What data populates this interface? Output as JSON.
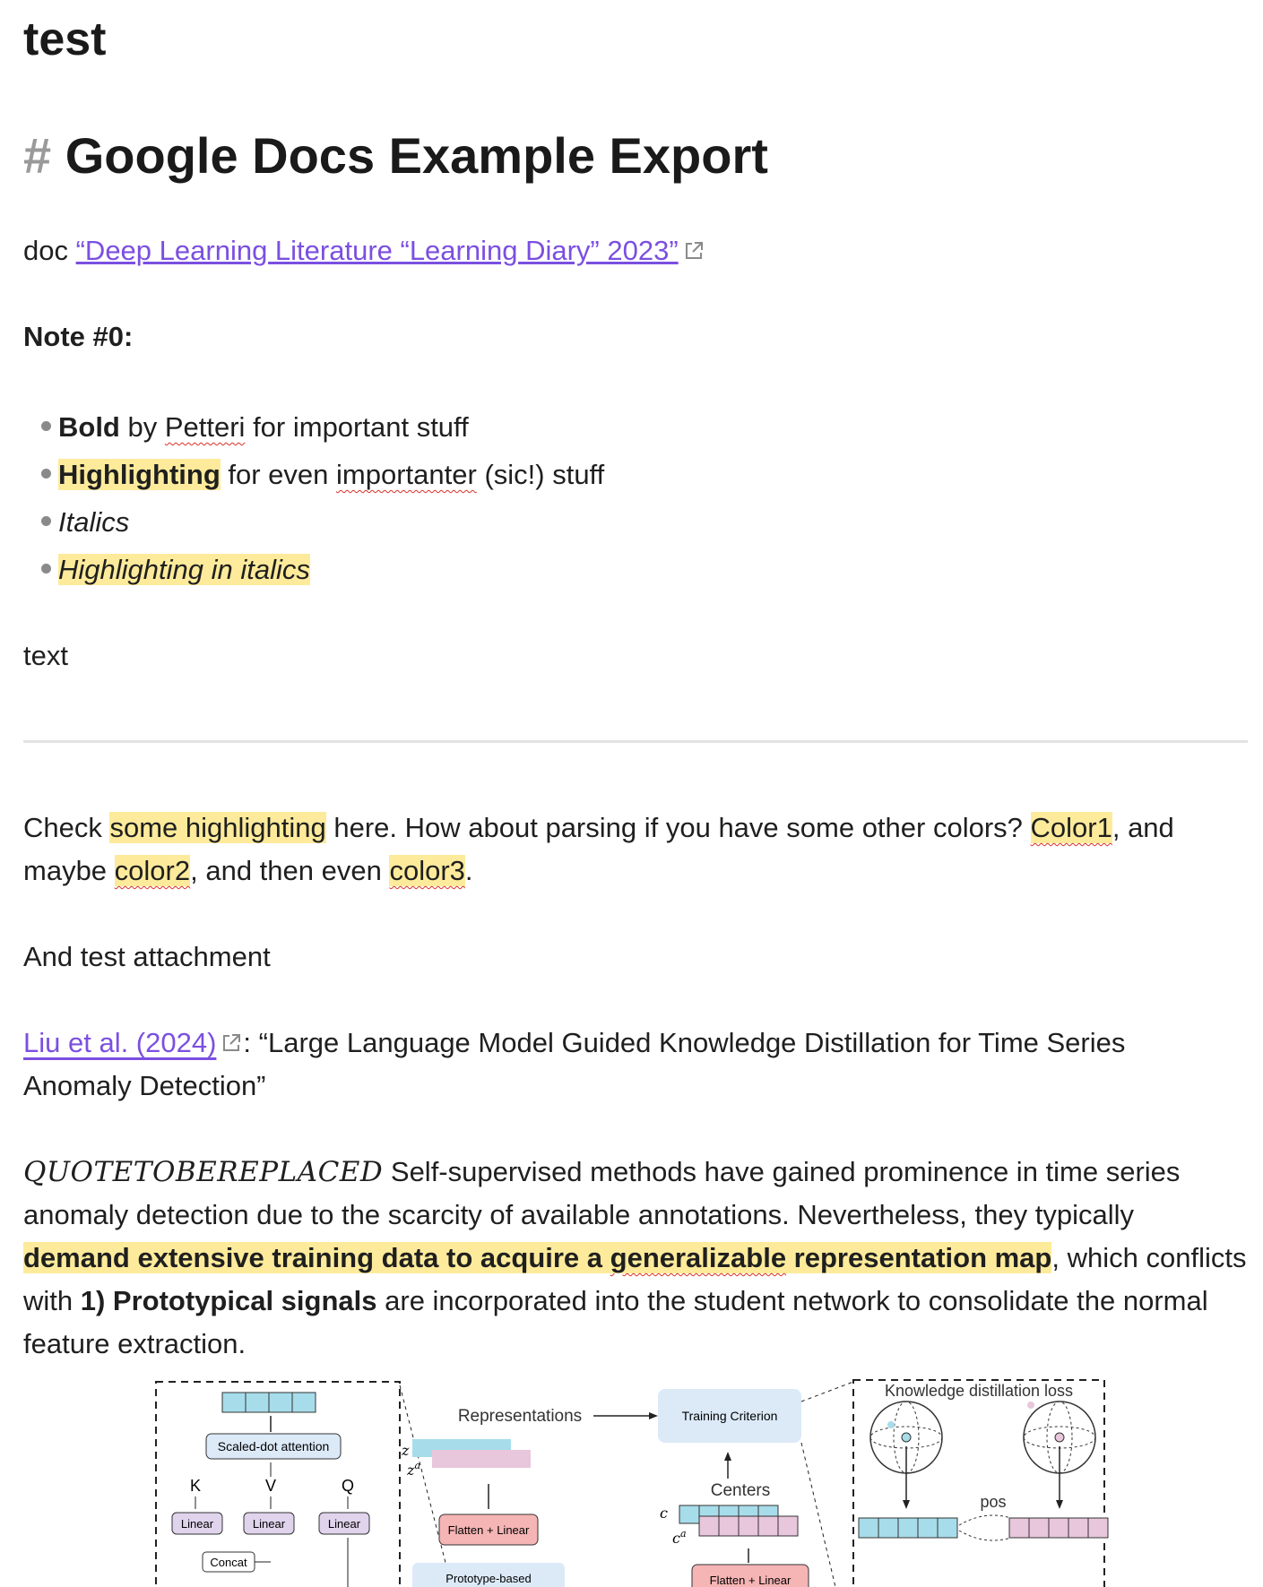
{
  "page": {
    "title": "test",
    "heading": {
      "hash": "#",
      "text": "Google Docs Example Export"
    },
    "doc_line": {
      "prefix": "doc ",
      "link_text": "“Deep Learning Literature “Learning Diary” 2023”",
      "link_icon": "external-link-icon"
    },
    "note_heading": "Note #0:",
    "bullets": [
      {
        "bold": "Bold",
        "by": " by ",
        "name": "Petteri",
        "rest": " for important stuff"
      },
      {
        "highlight": "Highlighting",
        "mid": " for even ",
        "word": "importanter",
        "rest": " (sic!) stuff"
      },
      {
        "italic": "Italics"
      },
      {
        "italic_highlight": "Highlighting in italics"
      }
    ],
    "text_line": "text",
    "colors_para": {
      "p1": "Check ",
      "h1": "some highlighting",
      "p2": " here. How about parsing if you have some other colors? ",
      "c1": "Color1",
      "p3": ", and",
      "p4": "maybe ",
      "c2": "color2",
      "p5": ", and then even ",
      "c3": "color3",
      "p6": "."
    },
    "attachment_line": "And test attachment",
    "citation": {
      "link_text": "Liu et al. (2024)",
      "title_1": ": “Large Language Model Guided Knowledge Distillation for Time Series",
      "title_2": "Anomaly Detection”"
    },
    "abstract": {
      "quote_token": "QUOTETOBEREPLACED",
      "l1": " Self-supervised methods have gained prominence in time series",
      "l2": "anomaly detection due to the scarcity of available annotations. Nevertheless, they typically",
      "l3_hl_a": "demand extensive training data to acquire a ",
      "l3_hl_b": "generalizable",
      "l3_hl_c": " representation map",
      "l3_rest": ", which conflicts",
      "l4_a": "with ",
      "l4_b": "1) Prototypical signals",
      "l4_c": " are incorporated into the student network to consolidate the normal",
      "l5": "feature extraction."
    },
    "figure": {
      "scaled_dot": "Scaled-dot attention",
      "k": "K",
      "v": "V",
      "q": "Q",
      "linear": "Linear",
      "concat": "Concat",
      "representations": "Representations",
      "z": "z",
      "za": "z",
      "sup_a": "a",
      "flatten_linear": "Flatten + Linear",
      "prototype_based": "Prototype-based",
      "training_criterion": "Training Criterion",
      "centers": "Centers",
      "c": "c",
      "ca": "c",
      "kd_loss": "Knowledge distillation loss",
      "pos": "pos",
      "colors": {
        "cyan": "#a7dcea",
        "pink": "#e8c6dc",
        "blue_box": "#dceaf8",
        "red_box": "#f6b5b5",
        "purple_box": "#e0d3ec"
      }
    }
  }
}
